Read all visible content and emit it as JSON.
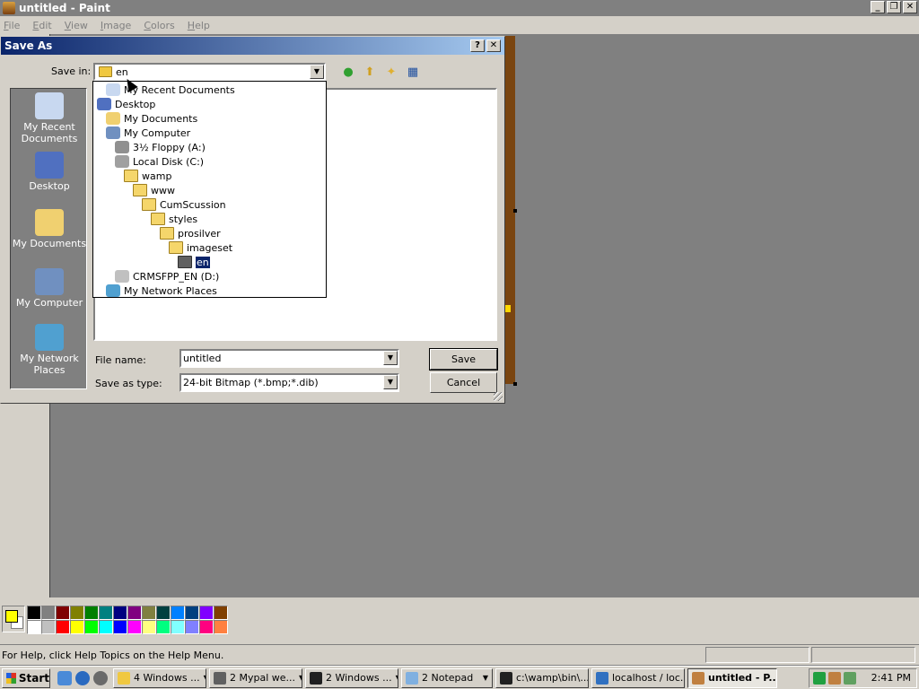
{
  "app": {
    "title": "untitled - Paint",
    "controls": [
      "_",
      "❐",
      "✕"
    ]
  },
  "menu": [
    "File",
    "Edit",
    "View",
    "Image",
    "Colors",
    "Help"
  ],
  "dialog": {
    "title": "Save As",
    "help_glyph": "?",
    "close_glyph": "✕",
    "save_in_label": "Save in:",
    "save_in_value": "en",
    "places": [
      {
        "label": "My Recent Documents",
        "icon": "recent-documents-icon"
      },
      {
        "label": "Desktop",
        "icon": "desktop-icon"
      },
      {
        "label": "My Documents",
        "icon": "my-documents-icon"
      },
      {
        "label": "My Computer",
        "icon": "my-computer-icon"
      },
      {
        "label": "My Network Places",
        "icon": "network-places-icon"
      }
    ],
    "file_name_label": "File name:",
    "file_name_value": "untitled",
    "save_as_type_label": "Save as type:",
    "save_as_type_value": "24-bit Bitmap (*.bmp;*.dib)",
    "save_button": "Save",
    "cancel_button": "Cancel"
  },
  "dropdown_items": [
    {
      "label": "My Recent Documents",
      "icon": "recent-documents-icon",
      "level": 1
    },
    {
      "label": "Desktop",
      "icon": "desktop-icon",
      "level": 0
    },
    {
      "label": "My Documents",
      "icon": "my-documents-icon",
      "level": 1
    },
    {
      "label": "My Computer",
      "icon": "my-computer-icon",
      "level": 1
    },
    {
      "label": "3½ Floppy (A:)",
      "icon": "floppy-icon",
      "level": 2
    },
    {
      "label": "Local Disk (C:)",
      "icon": "local-disk-icon",
      "level": 2
    },
    {
      "label": "wamp",
      "icon": "folder-icon",
      "level": 3
    },
    {
      "label": "www",
      "icon": "folder-icon",
      "level": 4
    },
    {
      "label": "CumScussion",
      "icon": "folder-icon",
      "level": 5
    },
    {
      "label": "styles",
      "icon": "folder-icon",
      "level": 6
    },
    {
      "label": "prosilver",
      "icon": "folder-icon",
      "level": 7
    },
    {
      "label": "imageset",
      "icon": "folder-icon",
      "level": 8
    },
    {
      "label": "en",
      "icon": "open-folder-icon",
      "level": 9,
      "selected": true
    },
    {
      "label": "CRMSFPP_EN (D:)",
      "icon": "cd-drive-icon",
      "level": 2
    },
    {
      "label": "My Network Places",
      "icon": "network-places-icon",
      "level": 1
    }
  ],
  "palette": {
    "foreground": "#ffff00",
    "background": "#ffffff",
    "colors": [
      "#000000",
      "#808080",
      "#800000",
      "#808000",
      "#008000",
      "#008080",
      "#000080",
      "#800080",
      "#808040",
      "#004040",
      "#0080ff",
      "#004080",
      "#8000ff",
      "#804000",
      "#ffffff",
      "#c0c0c0",
      "#ff0000",
      "#ffff00",
      "#00ff00",
      "#00ffff",
      "#0000ff",
      "#ff00ff",
      "#ffff80",
      "#00ff80",
      "#80ffff",
      "#8080ff",
      "#ff0080",
      "#ff8040"
    ]
  },
  "status": {
    "text": "For Help, click Help Topics on the Help Menu."
  },
  "taskbar": {
    "start": "Start",
    "tasks": [
      {
        "label": "4 Windows ...",
        "icon": "folder-icon",
        "grouped": true
      },
      {
        "label": "2 Mypal we...",
        "icon": "mypal-icon",
        "grouped": true
      },
      {
        "label": "2 Windows ...",
        "icon": "cmd-icon",
        "grouped": true
      },
      {
        "label": "2 Notepad",
        "icon": "notepad-icon",
        "grouped": true
      },
      {
        "label": "c:\\wamp\\bin\\...",
        "icon": "cmd-icon",
        "grouped": false
      },
      {
        "label": "localhost / loc...",
        "icon": "browser-icon",
        "grouped": false
      },
      {
        "label": "untitled - P...",
        "icon": "paint-icon",
        "grouped": false,
        "active": true
      }
    ],
    "clock": "2:41 PM"
  }
}
